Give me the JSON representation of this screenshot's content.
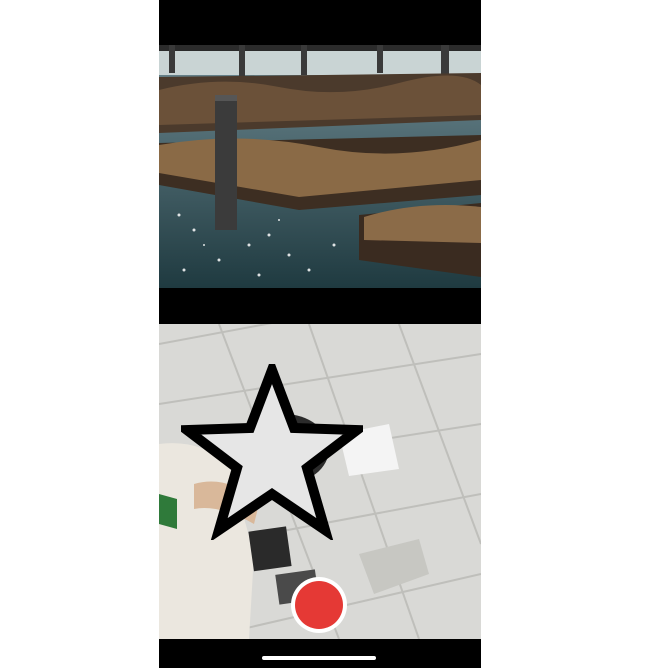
{
  "screen": {
    "top_media": "sea-lions-pier-photo",
    "bottom_media": "front-camera-preview-office-ceiling",
    "sticker": "star-icon"
  },
  "colors": {
    "record_button_fill": "#e53935",
    "record_button_ring": "#ffffff",
    "background": "#000000",
    "star_fill": "#e6e6e6",
    "star_outline": "#000000"
  },
  "controls": {
    "record_button": "record-button"
  }
}
